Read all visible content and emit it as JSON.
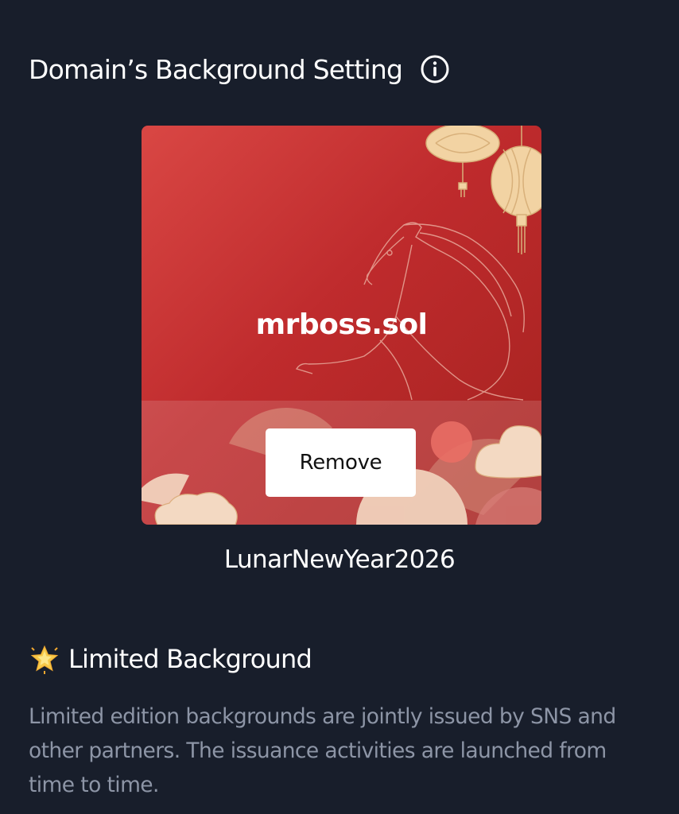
{
  "header": {
    "title": "Domain’s Background Setting",
    "info_icon": "info-circle-icon"
  },
  "preview": {
    "domain_name": "mrboss.sol",
    "remove_label": "Remove",
    "background_name": "LunarNewYear2026",
    "colors": {
      "card_red": "#c0302f",
      "gold": "#f2d3a3"
    }
  },
  "limited": {
    "icon": "glowing-star-icon",
    "title": "Limited Background",
    "description": "Limited edition backgrounds are jointly issued by SNS and other partners. The issuance activities are launched from time to time."
  },
  "theme": {
    "background": "#181e2b",
    "text_primary": "#ffffff",
    "text_secondary": "#8d95a6"
  }
}
